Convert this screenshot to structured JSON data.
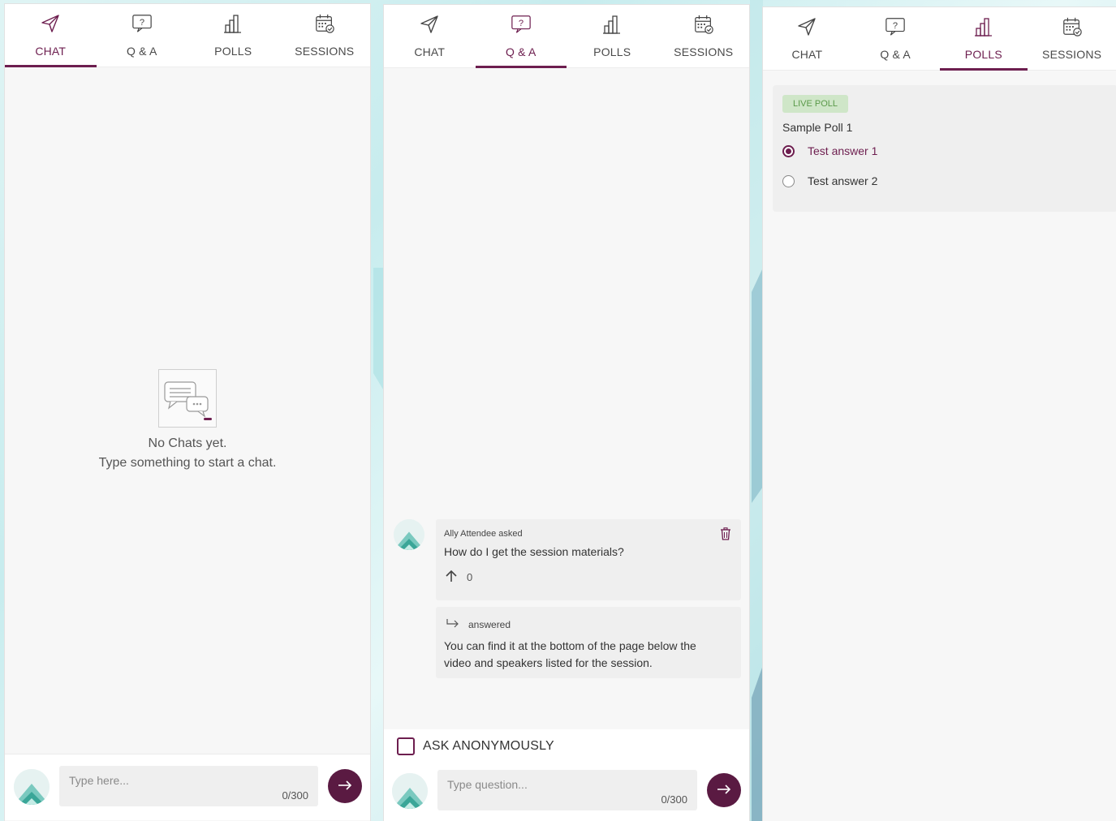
{
  "tabs": {
    "chat": "CHAT",
    "qa": "Q & A",
    "polls": "POLLS",
    "sessions": "SESSIONS"
  },
  "chat_panel": {
    "active_tab": "chat",
    "empty_title": "No Chats yet.",
    "empty_subtitle": "Type something to start a chat.",
    "input_placeholder": "Type here...",
    "counter": "0/300"
  },
  "qa_panel": {
    "active_tab": "qa",
    "question": {
      "asker": "Ally Attendee asked",
      "text": "How do I get the session materials?",
      "votes": "0"
    },
    "answer": {
      "label": "answered",
      "text": "You can find it at the bottom of the page below the video and speakers listed for the session."
    },
    "anonymous_label": "ASK ANONYMOUSLY",
    "input_placeholder": "Type question...",
    "counter": "0/300"
  },
  "polls_panel": {
    "active_tab": "polls",
    "badge": "LIVE POLL",
    "poll_title": "Sample Poll 1",
    "options": [
      {
        "label": "Test answer 1",
        "selected": true
      },
      {
        "label": "Test answer 2",
        "selected": false
      }
    ]
  },
  "colors": {
    "accent": "#6d1e4f",
    "send_button": "#5a1a42",
    "badge_bg": "#cfe6c8",
    "badge_text": "#5b9a4a"
  },
  "icons": {
    "chat": "paper-plane-icon",
    "qa": "question-bubble-icon",
    "polls": "bar-chart-icon",
    "sessions": "calendar-check-icon",
    "send": "arrow-right-icon",
    "delete": "trash-icon",
    "upvote": "arrow-up-icon",
    "answer": "reply-arrow-icon",
    "empty_chat": "chat-bubbles-icon"
  }
}
